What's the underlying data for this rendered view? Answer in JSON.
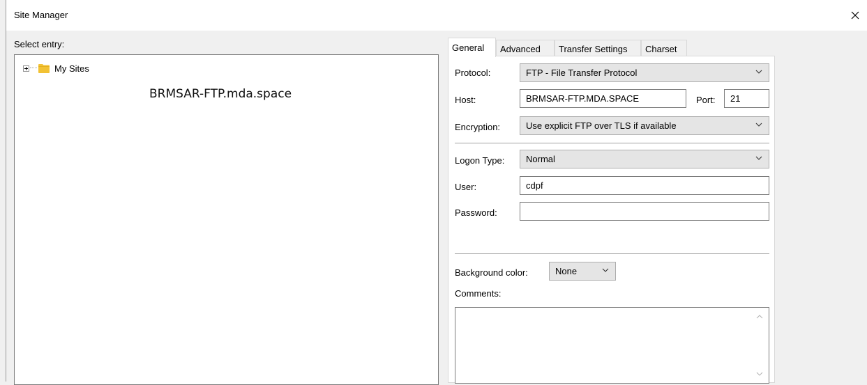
{
  "window": {
    "title": "Site Manager"
  },
  "left": {
    "select_label": "Select entry:",
    "tree": [
      {
        "label": "My Sites",
        "icon": "folder-icon",
        "expanded": false
      }
    ],
    "overlay_text": "BRMSAR-FTP.mda.space"
  },
  "tabs": [
    {
      "label": "General",
      "active": true
    },
    {
      "label": "Advanced",
      "active": false
    },
    {
      "label": "Transfer Settings",
      "active": false
    },
    {
      "label": "Charset",
      "active": false
    }
  ],
  "general": {
    "protocol": {
      "label": "Protocol:",
      "value": "FTP - File Transfer Protocol"
    },
    "host": {
      "label": "Host:",
      "value": "BRMSAR-FTP.MDA.SPACE"
    },
    "port": {
      "label": "Port:",
      "value": "21"
    },
    "encryption": {
      "label": "Encryption:",
      "value": "Use explicit FTP over TLS if available"
    },
    "logon_type": {
      "label": "Logon Type:",
      "value": "Normal"
    },
    "user": {
      "label": "User:",
      "value": "cdpf"
    },
    "password": {
      "label": "Password:",
      "value": ""
    },
    "background_color": {
      "label": "Background color:",
      "value": "None"
    },
    "comments": {
      "label": "Comments:",
      "value": ""
    }
  },
  "colors": {
    "folder": "#f2c234",
    "select_bg": "#e5e5e5",
    "panel_bg": "#ffffff",
    "window_bg": "#f0f0f0"
  }
}
